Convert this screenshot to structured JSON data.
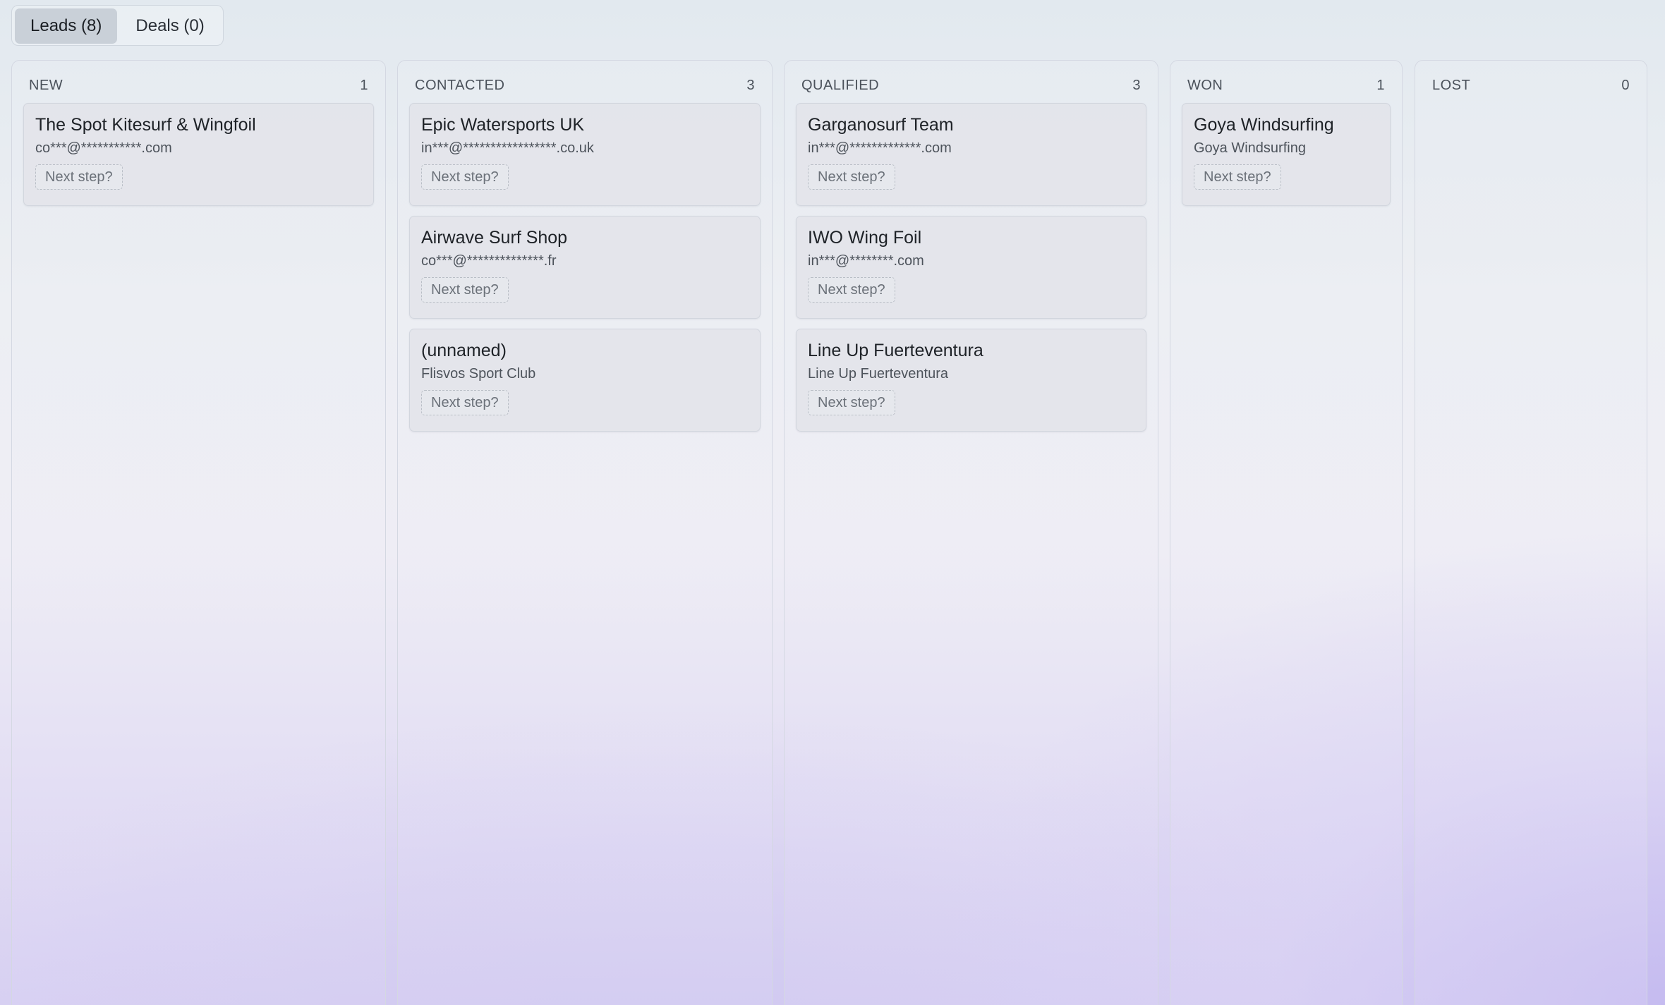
{
  "tabs": [
    {
      "label": "Leads (8)",
      "active": true
    },
    {
      "label": "Deals (0)",
      "active": false
    }
  ],
  "columns": [
    {
      "title": "NEW",
      "count": "1",
      "cards": [
        {
          "title": "The Spot Kitesurf & Wingfoil",
          "subtitle": "co***@***********.com",
          "next_step": "Next step?"
        }
      ]
    },
    {
      "title": "CONTACTED",
      "count": "3",
      "cards": [
        {
          "title": "Epic Watersports UK",
          "subtitle": "in***@*****************.co.uk",
          "next_step": "Next step?"
        },
        {
          "title": "Airwave Surf Shop",
          "subtitle": "co***@**************.fr",
          "next_step": "Next step?"
        },
        {
          "title": "(unnamed)",
          "subtitle": "Flisvos Sport Club",
          "next_step": "Next step?"
        }
      ]
    },
    {
      "title": "QUALIFIED",
      "count": "3",
      "cards": [
        {
          "title": "Garganosurf Team",
          "subtitle": "in***@*************.com",
          "next_step": "Next step?"
        },
        {
          "title": "IWO Wing Foil",
          "subtitle": "in***@********.com",
          "next_step": "Next step?"
        },
        {
          "title": "Line Up Fuerteventura",
          "subtitle": "Line Up Fuerteventura",
          "next_step": "Next step?"
        }
      ]
    },
    {
      "title": "WON",
      "count": "1",
      "cards": [
        {
          "title": "Goya Windsurfing",
          "subtitle": "Goya Windsurfing",
          "next_step": "Next step?"
        }
      ]
    },
    {
      "title": "LOST",
      "count": "0",
      "cards": []
    }
  ],
  "colors": {
    "card_bg": "#e2e4e9",
    "column_border": "#d4d8e2",
    "active_tab_bg": "#c9d0d8"
  }
}
